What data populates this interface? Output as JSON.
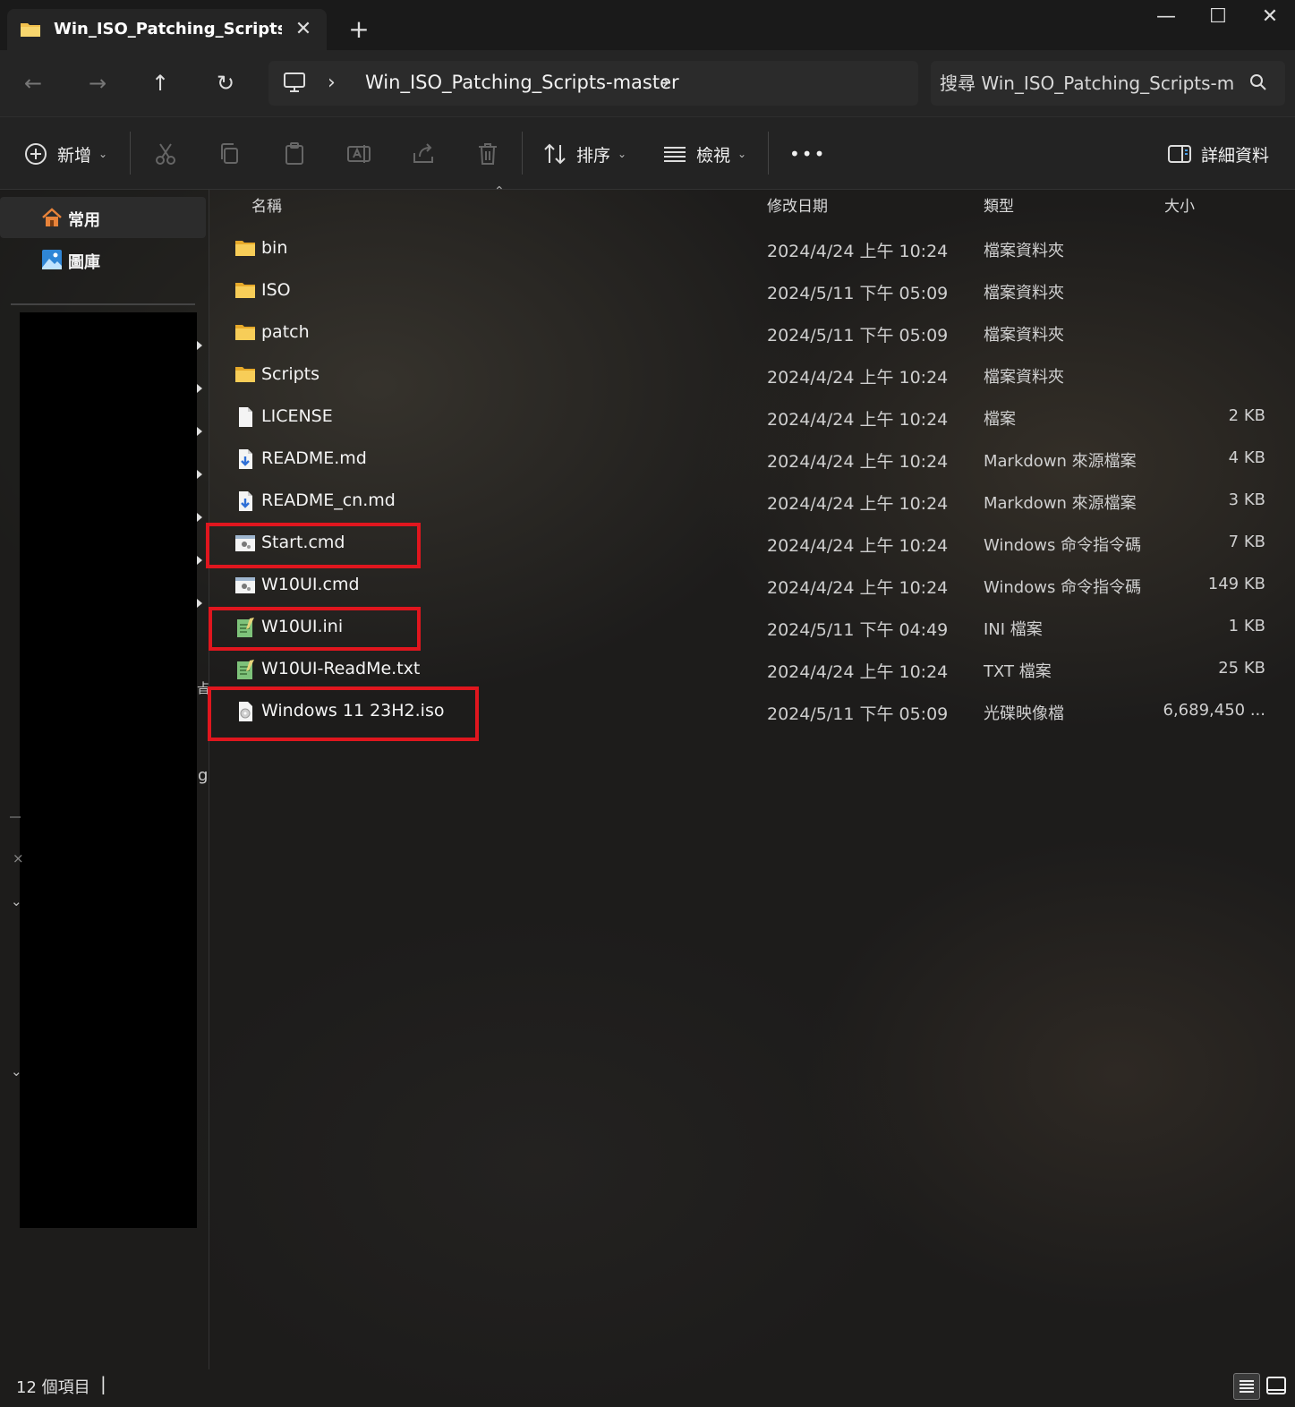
{
  "window": {
    "tab_title": "Win_ISO_Patching_Scripts-master",
    "close_tab": "✕",
    "new_tab": "+",
    "minimize": "—",
    "maximize": "☐",
    "close": "✕"
  },
  "nav": {
    "back": "←",
    "forward": "→",
    "up": "↑",
    "refresh": "↻",
    "breadcrumb_sep": "›",
    "breadcrumb": "Win_ISO_Patching_Scripts-master",
    "search_placeholder": "搜尋 Win_ISO_Patching_Scripts-m"
  },
  "toolbar": {
    "new_label": "新增",
    "sort_label": "排序",
    "view_label": "檢視",
    "more_label": "•••",
    "details_label": "詳細資料",
    "dropdown": "⌄"
  },
  "sidebar": {
    "items": [
      {
        "label": "常用",
        "icon": "home-icon"
      },
      {
        "label": "圖庫",
        "icon": "gallery-icon"
      }
    ],
    "stray_glyphs": [
      "㫖",
      "g",
      "×",
      "⌄",
      "⌄"
    ]
  },
  "columns": {
    "name": "名稱",
    "date": "修改日期",
    "type": "類型",
    "size": "大小",
    "sort_indicator": "⌃"
  },
  "files": [
    {
      "name": "bin",
      "date": "2024/4/24 上午 10:24",
      "type": "檔案資料夾",
      "size": "",
      "icon": "folder-icon"
    },
    {
      "name": "ISO",
      "date": "2024/5/11 下午 05:09",
      "type": "檔案資料夾",
      "size": "",
      "icon": "folder-icon"
    },
    {
      "name": "patch",
      "date": "2024/5/11 下午 05:09",
      "type": "檔案資料夾",
      "size": "",
      "icon": "folder-icon"
    },
    {
      "name": "Scripts",
      "date": "2024/4/24 上午 10:24",
      "type": "檔案資料夾",
      "size": "",
      "icon": "folder-icon"
    },
    {
      "name": "LICENSE",
      "date": "2024/4/24 上午 10:24",
      "type": "檔案",
      "size": "2 KB",
      "icon": "file-icon"
    },
    {
      "name": "README.md",
      "date": "2024/4/24 上午 10:24",
      "type": "Markdown 來源檔案",
      "size": "4 KB",
      "icon": "markdown-file-icon"
    },
    {
      "name": "README_cn.md",
      "date": "2024/4/24 上午 10:24",
      "type": "Markdown 來源檔案",
      "size": "3 KB",
      "icon": "markdown-file-icon"
    },
    {
      "name": "Start.cmd",
      "date": "2024/4/24 上午 10:24",
      "type": "Windows 命令指令碼",
      "size": "7 KB",
      "icon": "cmd-file-icon"
    },
    {
      "name": "W10UI.cmd",
      "date": "2024/4/24 上午 10:24",
      "type": "Windows 命令指令碼",
      "size": "149 KB",
      "icon": "cmd-file-icon"
    },
    {
      "name": "W10UI.ini",
      "date": "2024/5/11 下午 04:49",
      "type": "INI 檔案",
      "size": "1 KB",
      "icon": "text-file-icon"
    },
    {
      "name": "W10UI-ReadMe.txt",
      "date": "2024/4/24 上午 10:24",
      "type": "TXT 檔案",
      "size": "25 KB",
      "icon": "text-file-icon"
    },
    {
      "name": "Windows 11 23H2.iso",
      "date": "2024/5/11 下午 05:09",
      "type": "光碟映像檔",
      "size": "6,689,450 ...",
      "icon": "disc-image-icon"
    }
  ],
  "status": {
    "item_count": "12 個項目",
    "caret": "|"
  },
  "colors": {
    "highlight": "#e0161e",
    "folder": "#f2c14e",
    "accent": "#4a9fe8"
  }
}
